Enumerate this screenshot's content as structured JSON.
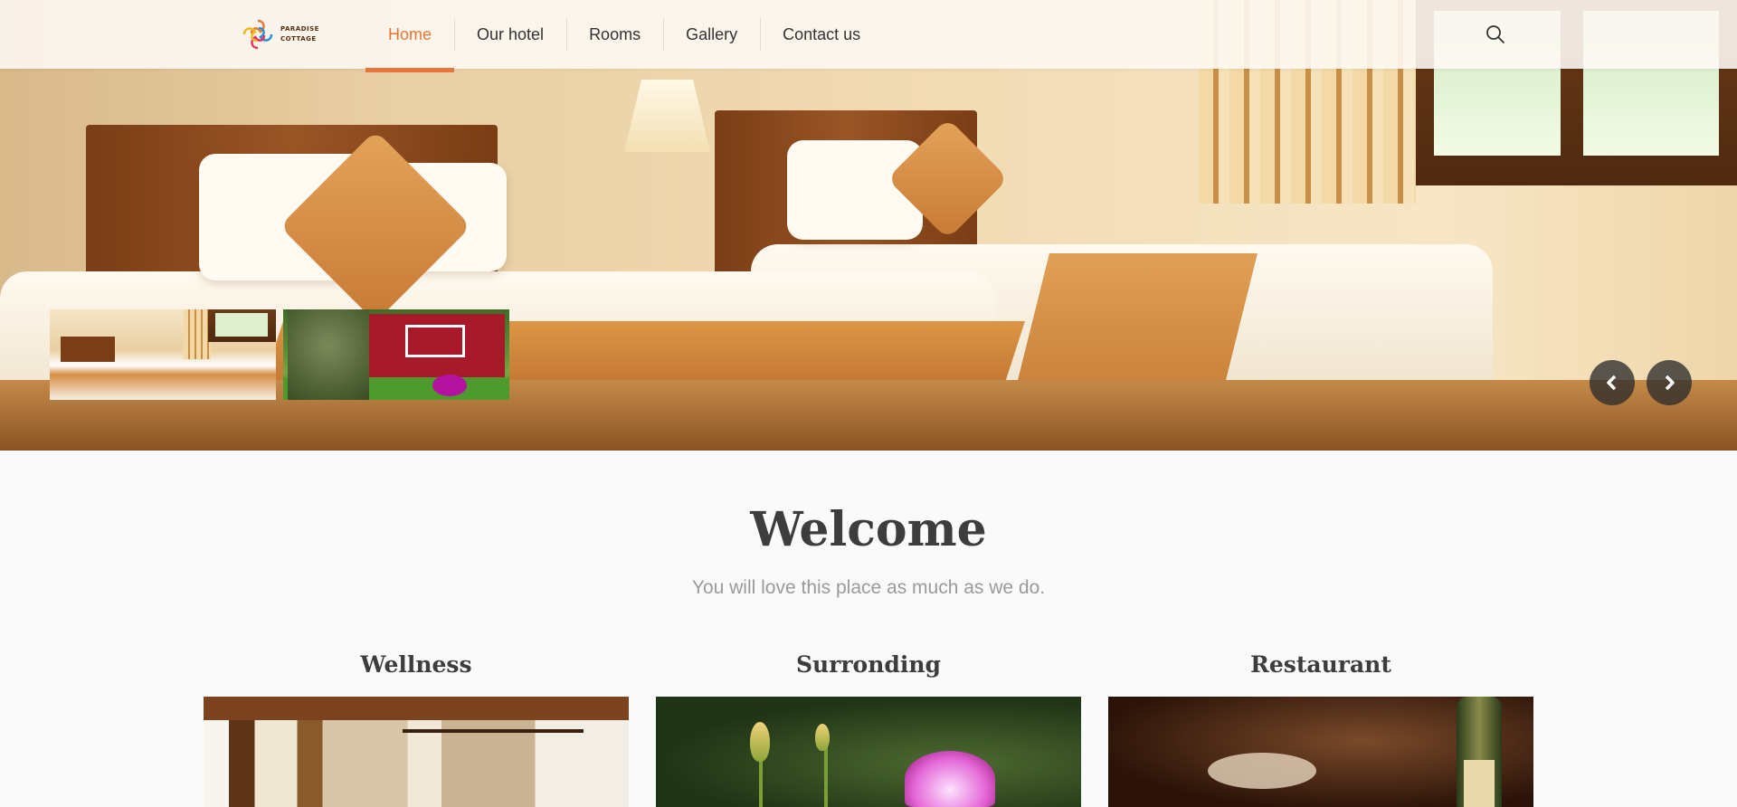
{
  "brand": {
    "logo_line1": "PARADISE",
    "logo_line2": "COTTAGE"
  },
  "nav": {
    "items": [
      {
        "label": "Home",
        "active": true
      },
      {
        "label": "Our hotel",
        "active": false
      },
      {
        "label": "Rooms",
        "active": false
      },
      {
        "label": "Gallery",
        "active": false
      },
      {
        "label": "Contact us",
        "active": false
      }
    ],
    "search_icon": "search-icon"
  },
  "slider": {
    "current_slide": "hotel room with twin beds",
    "thumbnails": [
      "room-thumbnail",
      "cottage-thumbnail"
    ],
    "prev_icon": "chevron-left-icon",
    "next_icon": "chevron-right-icon"
  },
  "welcome": {
    "title": "Welcome",
    "subtitle": "You will love this place as much as we do."
  },
  "features": [
    {
      "title": "Wellness"
    },
    {
      "title": "Surronding"
    },
    {
      "title": "Restaurant"
    }
  ],
  "colors": {
    "accent": "#e8763a",
    "text": "#333333",
    "muted": "#9a9a9a",
    "background": "#fafafa"
  }
}
